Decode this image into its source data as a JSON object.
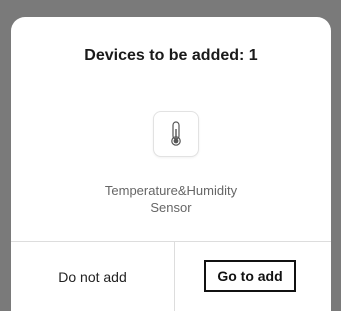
{
  "dialog": {
    "title": "Devices to be added: 1",
    "device": {
      "icon": "thermometer-icon",
      "name_line1": "Temperature&Humidity",
      "name_line2": "Sensor"
    },
    "buttons": {
      "cancel_label": "Do not add",
      "confirm_label": "Go to add"
    }
  },
  "colors": {
    "overlay": "#7a7a7a",
    "dialog_bg": "#ffffff",
    "title_text": "#1a1a1a",
    "secondary_text": "#666666",
    "divider": "#dddddd"
  }
}
